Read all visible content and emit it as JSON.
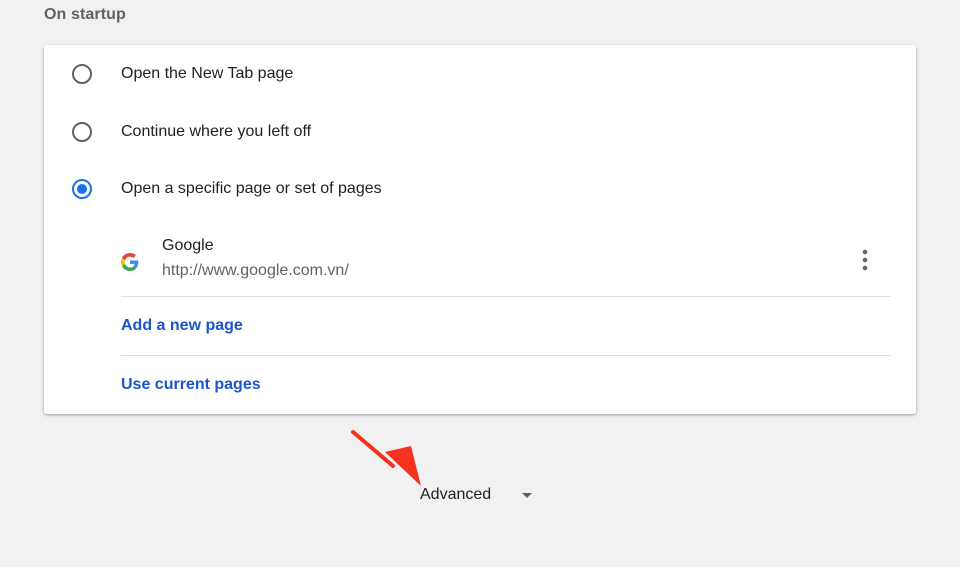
{
  "section": {
    "title": "On startup"
  },
  "options": [
    {
      "label": "Open the New Tab page",
      "checked": false
    },
    {
      "label": "Continue where you left off",
      "checked": false
    },
    {
      "label": "Open a specific page or set of pages",
      "checked": true
    }
  ],
  "startup_page": {
    "name": "Google",
    "url": "http://www.google.com.vn/",
    "favicon": "google-g-icon",
    "menu_icon": "more-vert-icon"
  },
  "links": {
    "add_new_page": "Add a new page",
    "use_current_pages": "Use current pages"
  },
  "advanced": {
    "label": "Advanced",
    "icon": "caret-down-icon"
  },
  "colors": {
    "accent": "#1a73e8",
    "link": "#1a56c7",
    "annotation": "#f5321e",
    "background": "#f1f1f1"
  }
}
